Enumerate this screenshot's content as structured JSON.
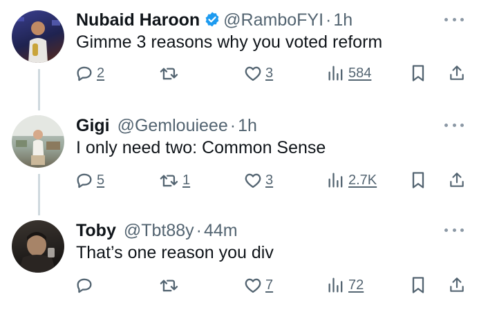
{
  "tweets": [
    {
      "name": "Nubaid Haroon",
      "verified": true,
      "handle": "@RamboFYI",
      "separator": "·",
      "time": "1h",
      "text": "Gimme 3 reasons why you voted reform",
      "replies": "2",
      "retweets": "",
      "likes": "3",
      "views": "584"
    },
    {
      "name": "Gigi",
      "verified": false,
      "handle": "@Gemlouieee",
      "separator": "·",
      "time": "1h",
      "text": "I only need two: Common Sense",
      "replies": "5",
      "retweets": "1",
      "likes": "3",
      "views": "2.7K"
    },
    {
      "name": "Toby",
      "verified": false,
      "handle": "@Tbt88y",
      "separator": "·",
      "time": "44m",
      "text": "That’s one reason you div",
      "replies": "",
      "retweets": "",
      "likes": "7",
      "views": "72"
    }
  ],
  "colors": {
    "text": "#0f1419",
    "secondary": "#536471",
    "verified": "#1d9bf0",
    "thread_line": "#cfd9de"
  },
  "icons": [
    "reply-icon",
    "retweet-icon",
    "like-icon",
    "views-icon",
    "bookmark-icon",
    "share-icon",
    "more-icon",
    "verified-badge-icon"
  ]
}
